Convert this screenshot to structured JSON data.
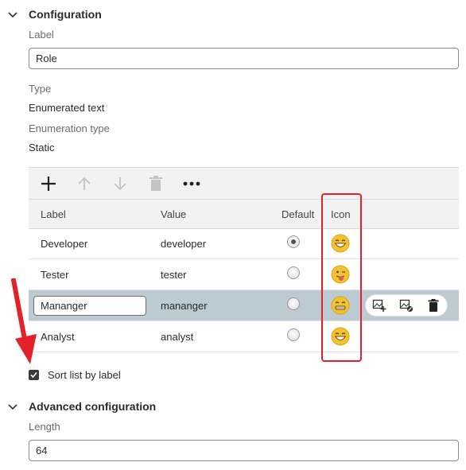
{
  "configuration": {
    "title": "Configuration",
    "label_caption": "Label",
    "label_value": "Role",
    "type_caption": "Type",
    "type_value": "Enumerated text",
    "enum_type_caption": "Enumeration type",
    "enum_type_value": "Static"
  },
  "toolbar": {
    "add_icon": "plus-icon",
    "move_up_icon": "arrow-up-icon",
    "move_down_icon": "arrow-down-icon",
    "delete_icon": "trash-icon",
    "more_icon": "more-icon"
  },
  "table": {
    "columns": [
      "Label",
      "Value",
      "Default",
      "Icon"
    ],
    "rows": [
      {
        "label": "Developer",
        "value": "developer",
        "default": true,
        "icon": "grinning-emoji"
      },
      {
        "label": "Tester",
        "value": "tester",
        "default": false,
        "icon": "tongue-out-emoji"
      },
      {
        "label": "Mananger",
        "value": "mananger",
        "default": false,
        "icon": "grimacing-emoji",
        "editing": true,
        "selected": true
      },
      {
        "label": "Analyst",
        "value": "analyst",
        "default": false,
        "icon": "grinning-emoji"
      }
    ],
    "row_actions": [
      "add-image-icon",
      "remove-image-icon",
      "trash-icon"
    ]
  },
  "sort": {
    "label": "Sort list by label",
    "checked": true
  },
  "advanced": {
    "title": "Advanced configuration",
    "length_caption": "Length",
    "length_value": "64"
  },
  "colors": {
    "selected_row": "#bccbd2",
    "highlight": "#e4202a",
    "emoji": "#f2c230"
  }
}
